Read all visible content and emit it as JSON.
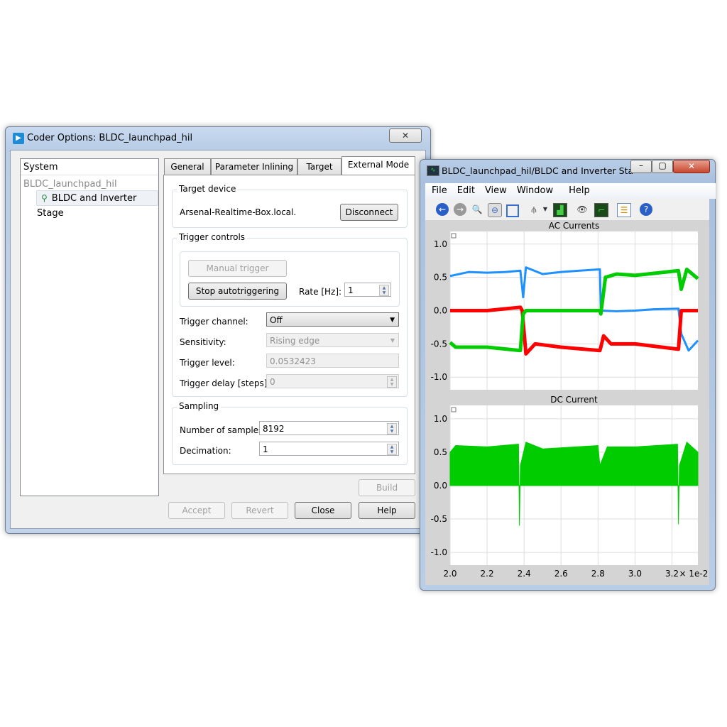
{
  "dialog": {
    "title": "Coder Options: BLDC_launchpad_hil",
    "tree": {
      "header": "System",
      "root": "BLDC_launchpad_hil",
      "child": "BLDC and Inverter Stage"
    },
    "tabs": [
      "General",
      "Parameter Inlining",
      "Target",
      "External Mode"
    ],
    "active_tab": "External Mode",
    "target_device": {
      "label": "Target device",
      "host": "Arsenal-Realtime-Box.local.",
      "disconnect": "Disconnect"
    },
    "trigger": {
      "label": "Trigger controls",
      "manual": "Manual trigger",
      "stop": "Stop autotriggering",
      "rate_label": "Rate [Hz]:",
      "rate": "1",
      "channel_label": "Trigger channel:",
      "channel": "Off",
      "sensitivity_label": "Sensitivity:",
      "sensitivity": "Rising edge",
      "level_label": "Trigger level:",
      "level": "0.0532423",
      "delay_label": "Trigger delay [steps]:",
      "delay": "0"
    },
    "sampling": {
      "label": "Sampling",
      "samples_label": "Number of samples:",
      "samples": "8192",
      "decimation_label": "Decimation:",
      "decimation": "1"
    },
    "buttons": {
      "build": "Build",
      "accept": "Accept",
      "revert": "Revert",
      "close": "Close",
      "help": "Help"
    }
  },
  "scope": {
    "title": "BLDC_launchpad_hil/BLDC and Inverter Sta...",
    "menu": [
      "File",
      "Edit",
      "View",
      "Window",
      "Help"
    ],
    "toolbar": [
      "back-icon",
      "forward-icon",
      "zoom-icon",
      "zoom-x-icon",
      "zoom-fit-icon",
      "cursor-icon",
      "spectrum-icon",
      "watch-add-icon",
      "signal-add-icon",
      "properties-icon",
      "help-icon"
    ],
    "x_multiplier": "× 1e-2"
  },
  "chart_data": [
    {
      "type": "line",
      "title": "AC Currents",
      "xlim": [
        2.0,
        3.34
      ],
      "ylim": [
        -1.19,
        1.19
      ],
      "grid": true,
      "xticks": [
        2.0,
        2.2,
        2.4,
        2.6,
        2.8,
        3.0,
        3.2
      ],
      "yticks": [
        1.0,
        0.5,
        0.0,
        -0.5,
        -1.0
      ],
      "series": [
        {
          "color": "#1e90ff",
          "points": [
            [
              2.0,
              0.52
            ],
            [
              2.1,
              0.58
            ],
            [
              2.2,
              0.57
            ],
            [
              2.3,
              0.58
            ],
            [
              2.38,
              0.6
            ],
            [
              2.395,
              0.2
            ],
            [
              2.41,
              0.65
            ],
            [
              2.5,
              0.55
            ],
            [
              2.6,
              0.58
            ],
            [
              2.7,
              0.6
            ],
            [
              2.81,
              0.62
            ],
            [
              2.815,
              0.0
            ],
            [
              2.9,
              -0.01
            ],
            [
              3.0,
              0.0
            ],
            [
              3.1,
              0.02
            ],
            [
              3.235,
              0.03
            ],
            [
              3.25,
              -0.35
            ],
            [
              3.29,
              -0.6
            ],
            [
              3.34,
              -0.45
            ]
          ]
        },
        {
          "color": "#ff0000",
          "points": [
            [
              2.0,
              0.0
            ],
            [
              2.2,
              0.0
            ],
            [
              2.38,
              0.05
            ],
            [
              2.39,
              0.0
            ],
            [
              2.41,
              -0.65
            ],
            [
              2.46,
              -0.5
            ],
            [
              2.6,
              -0.55
            ],
            [
              2.81,
              -0.6
            ],
            [
              2.815,
              -0.55
            ],
            [
              2.83,
              -0.38
            ],
            [
              2.87,
              -0.5
            ],
            [
              3.0,
              -0.5
            ],
            [
              3.235,
              -0.58
            ],
            [
              3.25,
              0.0
            ],
            [
              3.34,
              0.0
            ]
          ]
        },
        {
          "color": "#00cc00",
          "points": [
            [
              2.0,
              -0.48
            ],
            [
              2.03,
              -0.55
            ],
            [
              2.2,
              -0.55
            ],
            [
              2.38,
              -0.6
            ],
            [
              2.395,
              -0.05
            ],
            [
              2.41,
              0.0
            ],
            [
              2.6,
              0.0
            ],
            [
              2.81,
              0.0
            ],
            [
              2.815,
              -0.05
            ],
            [
              2.84,
              0.5
            ],
            [
              2.9,
              0.55
            ],
            [
              3.0,
              0.53
            ],
            [
              3.235,
              0.6
            ],
            [
              3.25,
              0.32
            ],
            [
              3.28,
              0.62
            ],
            [
              3.34,
              0.48
            ]
          ]
        }
      ]
    },
    {
      "type": "area",
      "title": "DC Current",
      "xlim": [
        2.0,
        3.34
      ],
      "ylim": [
        -1.19,
        1.2
      ],
      "grid": true,
      "xticks": [
        2.0,
        2.2,
        2.4,
        2.6,
        2.8,
        3.0,
        3.2
      ],
      "yticks": [
        1.0,
        0.5,
        0.0,
        -0.5,
        -1.0
      ],
      "series": [
        {
          "color": "#00cc00",
          "points": [
            [
              2.0,
              0.5
            ],
            [
              2.03,
              0.6
            ],
            [
              2.2,
              0.58
            ],
            [
              2.37,
              0.62
            ],
            [
              2.375,
              -0.6
            ],
            [
              2.38,
              0.3
            ],
            [
              2.41,
              0.65
            ],
            [
              2.5,
              0.55
            ],
            [
              2.8,
              0.6
            ],
            [
              2.81,
              0.3
            ],
            [
              2.85,
              0.58
            ],
            [
              3.0,
              0.58
            ],
            [
              3.23,
              0.62
            ],
            [
              3.235,
              -0.58
            ],
            [
              3.24,
              0.3
            ],
            [
              3.28,
              0.65
            ],
            [
              3.34,
              0.5
            ]
          ]
        }
      ]
    }
  ]
}
